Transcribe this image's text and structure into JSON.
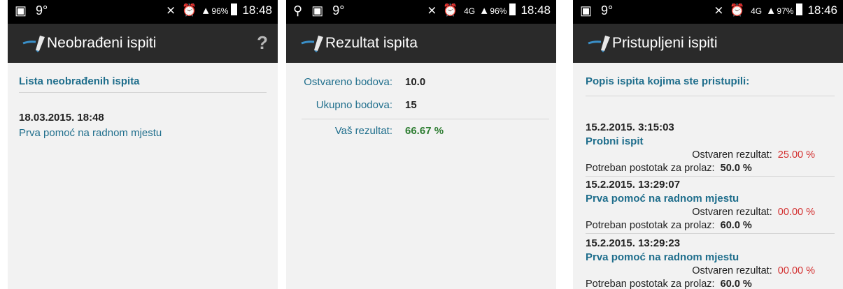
{
  "status": {
    "temp": "9°",
    "screen1": {
      "battery": "96%",
      "time": "18:48"
    },
    "screen2": {
      "network": "4G",
      "battery": "96%",
      "time": "18:48"
    },
    "screen3": {
      "network": "4G",
      "battery": "97%",
      "time": "18:46"
    }
  },
  "screen1": {
    "title": "Neobrađeni ispiti",
    "help": "?",
    "header": "Lista neobrađenih ispita",
    "exam_date": "18.03.2015. 18:48",
    "exam_name": "Prva pomoć na radnom mjestu"
  },
  "screen2": {
    "title": "Rezultat ispita",
    "achieved_label": "Ostvareno bodova:",
    "achieved_value": "10.0",
    "total_label": "Ukupno bodova:",
    "total_value": "15",
    "result_label": "Vaš rezultat:",
    "result_value": "66.67 %"
  },
  "screen3": {
    "title": "Pristupljeni ispiti",
    "header": "Popis ispita kojima ste pristupili:",
    "result_label": "Ostvaren rezultat:",
    "pass_label": "Potreban postotak za prolaz:",
    "items": [
      {
        "date": "15.2.2015. 3:15:03",
        "name": "Probni ispit",
        "result": "25.00 %",
        "pass": "50.0 %"
      },
      {
        "date": "15.2.2015. 13:29:07",
        "name": "Prva pomoć na radnom mjestu",
        "result": "00.00 %",
        "pass": "60.0 %"
      },
      {
        "date": "15.2.2015. 13:29:23",
        "name": "Prva pomoć na radnom mjestu",
        "result": "00.00 %",
        "pass": "60.0 %"
      }
    ]
  },
  "colors": {
    "accent": "#1f6e8c",
    "success": "#2e7d32",
    "error": "#d32f2f",
    "actionbar": "#2a2a2a"
  }
}
